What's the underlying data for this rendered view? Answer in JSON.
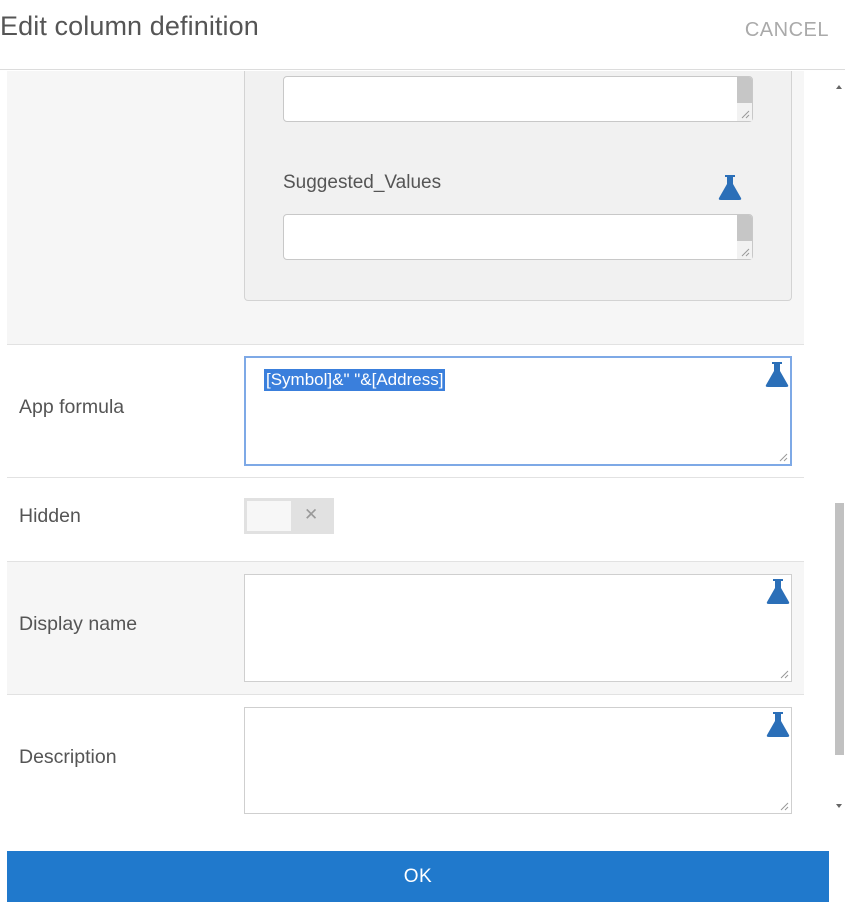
{
  "dialog": {
    "title": "Edit column definition",
    "cancel_label": "CANCEL",
    "ok_label": "OK"
  },
  "nested_panel": {
    "field1_value": "",
    "suggested_values_label": "Suggested_Values",
    "suggested_values_value": "",
    "icon": "flask-icon"
  },
  "rows": {
    "app_formula": {
      "label": "App formula",
      "value": "[Symbol]&\" \"&[Address]",
      "selected": true,
      "icon": "flask-icon"
    },
    "hidden": {
      "label": "Hidden",
      "toggle_state": "off",
      "toggle_glyph": "✕"
    },
    "display_name": {
      "label": "Display name",
      "value": "",
      "icon": "flask-icon"
    },
    "description": {
      "label": "Description",
      "value": "",
      "icon": "flask-icon"
    }
  },
  "colors": {
    "accent": "#2079cc",
    "flask_icon": "#2b6fb8",
    "selection": "#3a7fdc",
    "focus_border": "#7ea9e6"
  }
}
